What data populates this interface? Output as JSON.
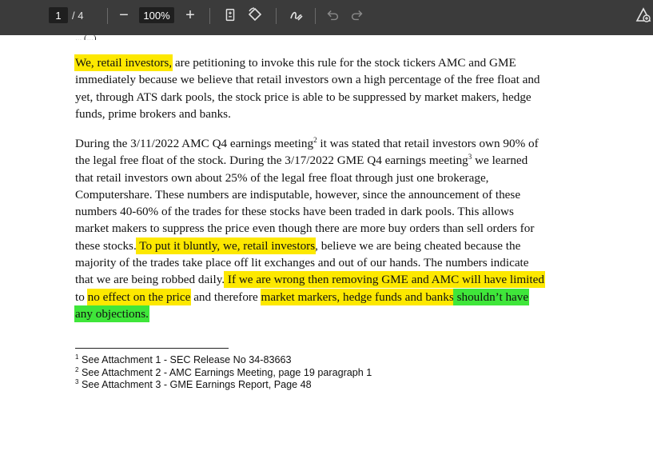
{
  "toolbar": {
    "current_page": "1",
    "page_separator": "/",
    "total_pages": "4",
    "zoom": "100%",
    "zoom_out_label": "−",
    "zoom_in_label": "+"
  },
  "document": {
    "clipped_line": "... (...)",
    "p1": {
      "l1_hl": "We, retail investors,",
      "l1_rest": " are petitioning to invoke this rule for the stock tickers AMC and GME",
      "l2": "immediately because we believe that retail investors own a high percentage of the free float and",
      "l3": "yet, through ATS dark pools, the stock price is able to be suppressed by market makers, hedge",
      "l4": "funds, prime brokers and banks."
    },
    "p2": {
      "l1_a": "During the 3/11/2022 AMC Q4 earnings meeting",
      "l1_sup": "2",
      "l1_b": " it was stated that retail investors own 90% of",
      "l2_a": "the legal free float of the stock. During the 3/17/2022 GME Q4 earnings meeting",
      "l2_sup": "3",
      "l2_b": " we learned",
      "l3": "that retail investors own about 25% of the legal free float through just one brokerage,",
      "l4": "Computershare. These numbers are indisputable, however, since the announcement of these",
      "l5": "numbers 40-60% of the trades for these stocks have been traded in dark pools. This allows",
      "l6": "market makers to suppress the price even though there are more buy orders than sell orders for",
      "l7_a": "these stocks.",
      "l7_hl": " To put it bluntly, we, retail investors",
      "l7_b": ", believe we are being cheated because the",
      "l8": "majority of the trades take place off lit exchanges and out of our hands. The numbers indicate",
      "l9_a": "that we are being robbed daily.",
      "l9_hl": " If we are wrong then removing GME and AMC will have limited",
      "l10_a": "to ",
      "l10_hl1": "no effect on the price",
      "l10_b": " and therefore ",
      "l10_hl2": "market markers, hedge funds and banks",
      "l10_g": " shouldn’t have",
      "l11_g": "any objections."
    },
    "footnotes": [
      {
        "num": "1",
        "text": " See Attachment 1 - SEC Release No 34-83663"
      },
      {
        "num": "2",
        "text": " See Attachment 2 - AMC Earnings Meeting, page 19 paragraph 1"
      },
      {
        "num": "3",
        "text": " See Attachment 3 - GME Earnings Report, Page 48"
      }
    ]
  },
  "colors": {
    "toolbar_bg": "#3b3b3b",
    "highlight_yellow": "#fde800",
    "highlight_green": "#3fe63a"
  }
}
